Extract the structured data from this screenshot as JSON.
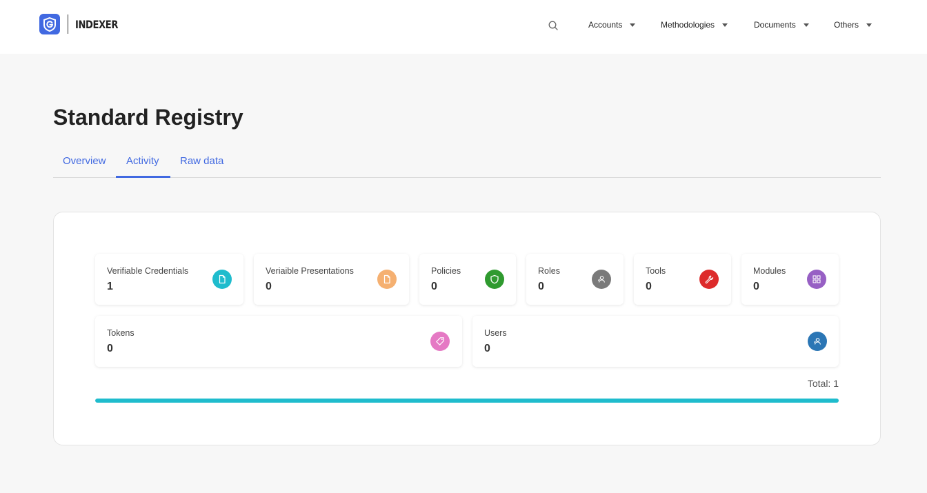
{
  "header": {
    "brand": "INDEXER",
    "nav": [
      {
        "label": "Accounts"
      },
      {
        "label": "Methodologies"
      },
      {
        "label": "Documents"
      },
      {
        "label": "Others"
      }
    ]
  },
  "page": {
    "title": "Standard Registry",
    "tabs": [
      {
        "label": "Overview",
        "active": false
      },
      {
        "label": "Activity",
        "active": true
      },
      {
        "label": "Raw data",
        "active": false
      }
    ]
  },
  "stats": [
    {
      "label": "Verifiable Credentials",
      "value": "1",
      "icon": "document-icon",
      "color": "#1fbccd"
    },
    {
      "label": "Veriaible Presentations",
      "value": "0",
      "icon": "document-icon",
      "color": "#f5b071"
    },
    {
      "label": "Policies",
      "value": "0",
      "icon": "shield-icon",
      "color": "#2f9a2f"
    },
    {
      "label": "Roles",
      "value": "0",
      "icon": "user-group-icon",
      "color": "#7a7a7a"
    },
    {
      "label": "Tools",
      "value": "0",
      "icon": "wrench-icon",
      "color": "#dd2b2b"
    },
    {
      "label": "Modules",
      "value": "0",
      "icon": "modules-icon",
      "color": "#9760c4"
    },
    {
      "label": "Tokens",
      "value": "0",
      "icon": "tag-icon",
      "color": "#e579c4"
    },
    {
      "label": "Users",
      "value": "0",
      "icon": "users-icon",
      "color": "#2b76b5"
    }
  ],
  "total": {
    "text": "Total: 1",
    "progress": 1.0
  },
  "colors": {
    "accent": "#4169e1",
    "progress": "#1fbccd"
  }
}
